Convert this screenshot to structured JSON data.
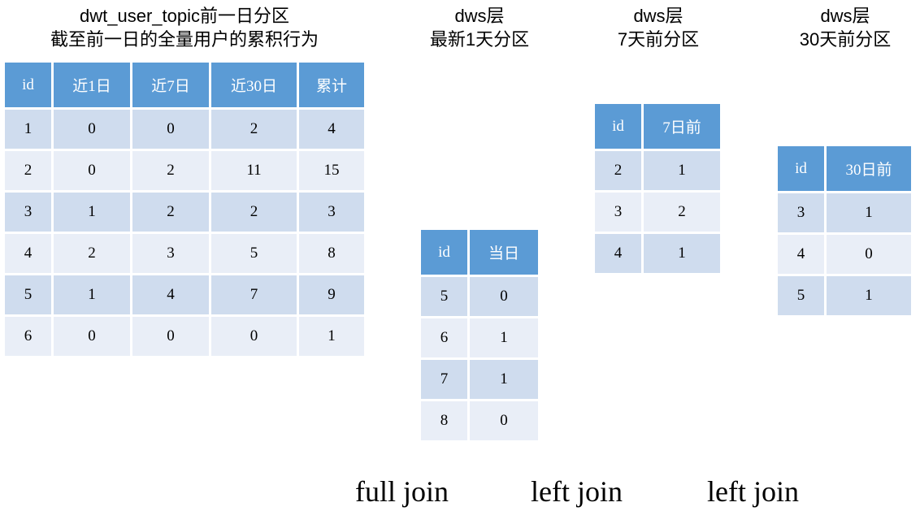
{
  "titles": {
    "dwt": [
      "dwt_user_topic前一日分区",
      "截至前一日的全量用户的累积行为"
    ],
    "dws_1d": [
      "dws层",
      "最新1天分区"
    ],
    "dws_7d": [
      "dws层",
      "7天前分区"
    ],
    "dws_30d": [
      "dws层",
      "30天前分区"
    ]
  },
  "tables": {
    "dwt": {
      "headers": [
        "id",
        "近1日",
        "近7日",
        "近30日",
        "累计"
      ],
      "rows": [
        [
          "1",
          "0",
          "0",
          "2",
          "4"
        ],
        [
          "2",
          "0",
          "2",
          "11",
          "15"
        ],
        [
          "3",
          "1",
          "2",
          "2",
          "3"
        ],
        [
          "4",
          "2",
          "3",
          "5",
          "8"
        ],
        [
          "5",
          "1",
          "4",
          "7",
          "9"
        ],
        [
          "6",
          "0",
          "0",
          "0",
          "1"
        ]
      ]
    },
    "dws_1d": {
      "headers": [
        "id",
        "当日"
      ],
      "rows": [
        [
          "5",
          "0"
        ],
        [
          "6",
          "1"
        ],
        [
          "7",
          "1"
        ],
        [
          "8",
          "0"
        ]
      ]
    },
    "dws_7d": {
      "headers": [
        "id",
        "7日前"
      ],
      "rows": [
        [
          "2",
          "1"
        ],
        [
          "3",
          "2"
        ],
        [
          "4",
          "1"
        ]
      ]
    },
    "dws_30d": {
      "headers": [
        "id",
        "30日前"
      ],
      "rows": [
        [
          "3",
          "1"
        ],
        [
          "4",
          "0"
        ],
        [
          "5",
          "1"
        ]
      ]
    }
  },
  "joins": [
    "full join",
    "left join",
    "left join"
  ]
}
